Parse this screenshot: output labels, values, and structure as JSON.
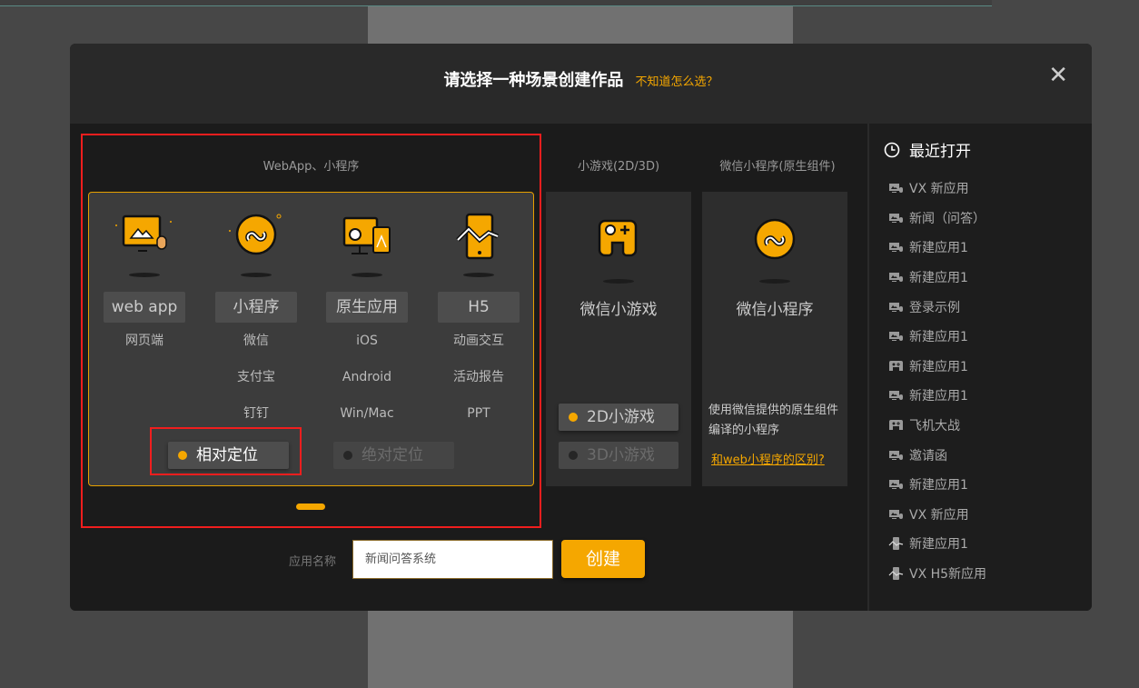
{
  "dialog": {
    "title": "请选择一种场景创建作品",
    "help_link": "不知道怎么选？",
    "close": "✕"
  },
  "webapp_section": {
    "title": "WebApp、小程序",
    "columns": [
      {
        "tag": "web app",
        "platforms": [
          "网页端"
        ],
        "icon": "monitor-mouse-icon"
      },
      {
        "tag": "小程序",
        "platforms": [
          "微信",
          "支付宝",
          "钉钉"
        ],
        "icon": "mini-program-icon"
      },
      {
        "tag": "原生应用",
        "platforms": [
          "iOS",
          "Android",
          "Win/Mac"
        ],
        "icon": "desktop-app-icon"
      },
      {
        "tag": "H5",
        "platforms": [
          "动画交互",
          "活动报告",
          "PPT"
        ],
        "icon": "phone-chart-icon"
      }
    ],
    "layout_options": [
      {
        "label": "相对定位",
        "selected": true
      },
      {
        "label": "绝对定位",
        "selected": false
      }
    ]
  },
  "game_section": {
    "title": "小游戏(2D/3D)",
    "card_title": "微信小游戏",
    "options": [
      {
        "label": "2D小游戏",
        "selected": true
      },
      {
        "label": "3D小游戏",
        "selected": false
      }
    ]
  },
  "native_section": {
    "title": "微信小程序(原生组件)",
    "card_title": "微信小程序",
    "description": "使用微信提供的原生组件编译的小程序",
    "link": "和web小程序的区别?"
  },
  "form": {
    "name_label": "应用名称",
    "name_value": "新闻问答系统",
    "create_button": "创建"
  },
  "recent": {
    "title": "最近打开",
    "items": [
      {
        "label": "VX 新应用",
        "icon": "webapp"
      },
      {
        "label": "新闻（问答）",
        "icon": "webapp"
      },
      {
        "label": "新建应用1",
        "icon": "webapp"
      },
      {
        "label": "新建应用1",
        "icon": "webapp"
      },
      {
        "label": "登录示例",
        "icon": "webapp"
      },
      {
        "label": "新建应用1",
        "icon": "webapp"
      },
      {
        "label": "新建应用1",
        "icon": "game"
      },
      {
        "label": "新建应用1",
        "icon": "webapp"
      },
      {
        "label": "飞机大战",
        "icon": "game"
      },
      {
        "label": "邀请函",
        "icon": "webapp"
      },
      {
        "label": "新建应用1",
        "icon": "webapp"
      },
      {
        "label": "VX 新应用",
        "icon": "webapp"
      },
      {
        "label": "新建应用1",
        "icon": "h5"
      },
      {
        "label": "VX H5新应用",
        "icon": "h5"
      }
    ]
  },
  "colors": {
    "accent": "#f5a700",
    "highlight": "#f01e1e",
    "modal_bg": "#1b1b1b"
  }
}
